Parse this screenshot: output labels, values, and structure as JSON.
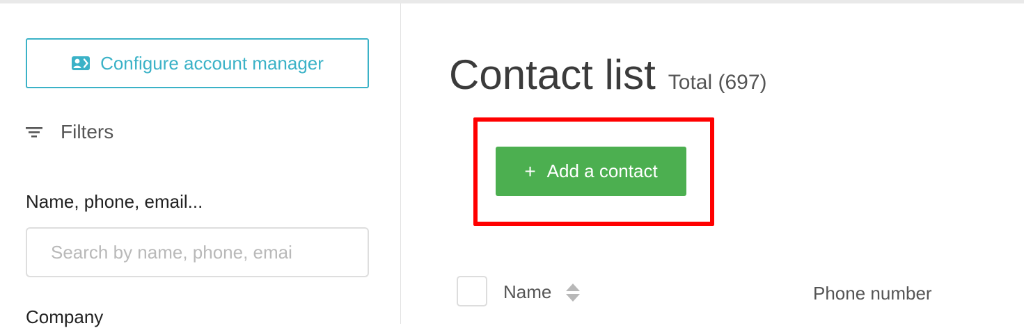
{
  "sidebar": {
    "configure_button": "Configure account manager",
    "filters_label": "Filters",
    "search_label": "Name, phone, email...",
    "search_placeholder": "Search by name, phone, emai",
    "search_value": "",
    "company_label": "Company"
  },
  "main": {
    "title": "Contact list",
    "total": "Total (697)",
    "add_button": "Add a contact",
    "add_icon": "+",
    "table": {
      "columns": [
        "Name",
        "Phone number"
      ]
    }
  },
  "icons": {
    "configure": "contact-card-icon",
    "filters": "filter-lines-icon",
    "sort": "sort-arrows-icon",
    "add": "plus-icon"
  },
  "colors": {
    "accent_teal": "#3bb2c7",
    "button_green": "#4caf50",
    "highlight_red": "#ff0000"
  }
}
